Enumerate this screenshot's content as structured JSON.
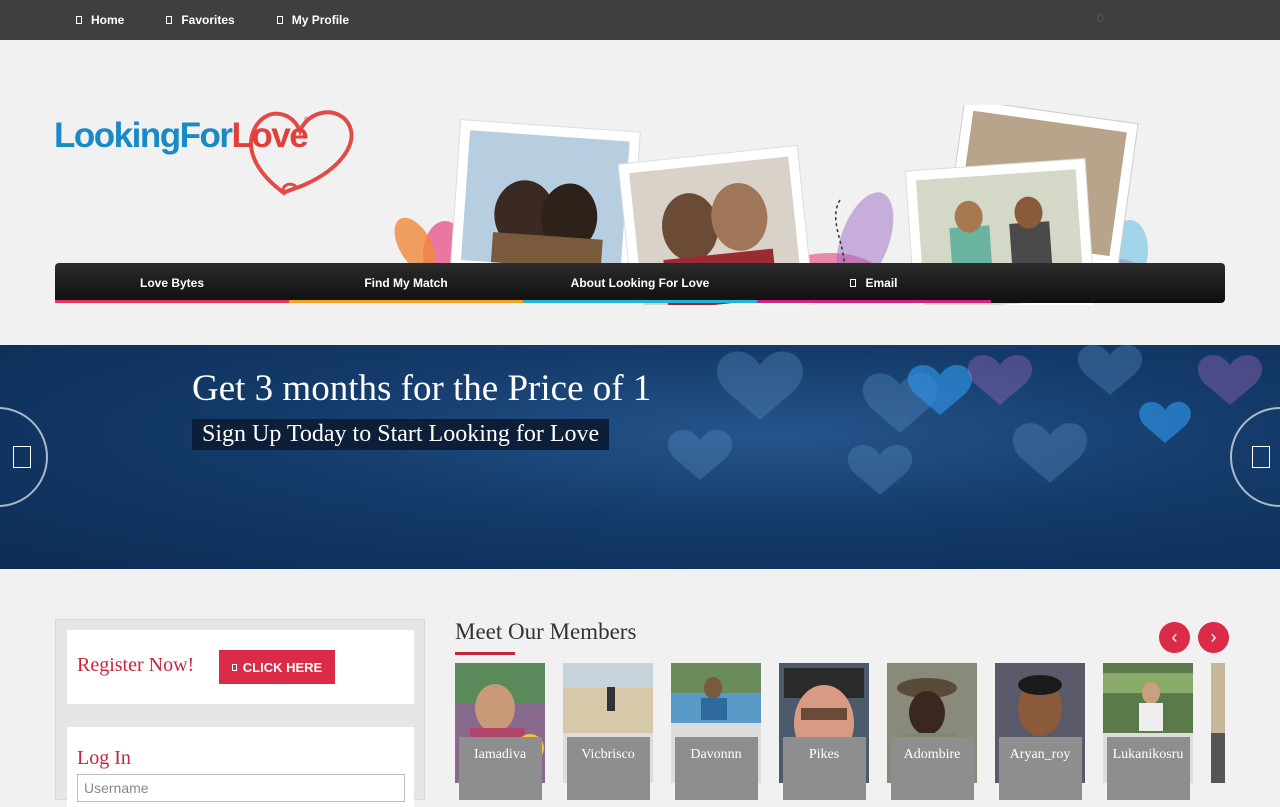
{
  "topnav": {
    "items": [
      {
        "label": "Home"
      },
      {
        "label": "Favorites"
      },
      {
        "label": "My Profile"
      }
    ],
    "cart_count": "0"
  },
  "logo": {
    "part1": "Looking",
    "part2": "For",
    "part3": "Love",
    "registered": "®"
  },
  "mainnav": {
    "items": [
      {
        "label": "Love Bytes",
        "color": "#e8335d"
      },
      {
        "label": "Find My Match",
        "color": "#f2a51c"
      },
      {
        "label": "About Looking For Love",
        "color": "#22b3e0"
      },
      {
        "label": "Email",
        "color": "#d61f84"
      }
    ]
  },
  "banner": {
    "title": "Get 3 months for the Price of 1",
    "subtitle": "Sign Up Today to Start Looking for Love"
  },
  "register": {
    "title": "Register Now!",
    "button_label": "CLICK HERE"
  },
  "login": {
    "title": "Log In",
    "username_placeholder": "Username"
  },
  "members": {
    "title": "Meet Our Members",
    "list": [
      {
        "name": "Iamadiva"
      },
      {
        "name": "Vicbrisco"
      },
      {
        "name": "Davonnn"
      },
      {
        "name": "Pikes"
      },
      {
        "name": "Adombire"
      },
      {
        "name": "Aryan_roy"
      },
      {
        "name": "Lukanikosru"
      }
    ]
  },
  "colors": {
    "accent": "#dc2b48",
    "topbar": "#3f3f3f",
    "banner": "#143b6a"
  }
}
